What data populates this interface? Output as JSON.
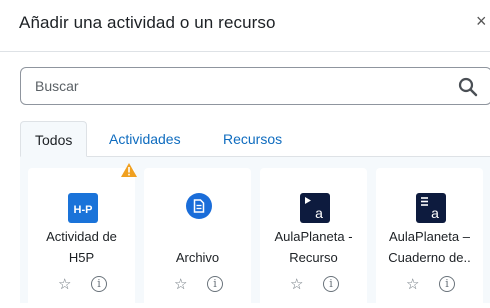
{
  "modal": {
    "title": "Añadir una actividad o un recurso",
    "close_glyph": "×"
  },
  "search": {
    "placeholder": "Buscar",
    "value": ""
  },
  "tabs": [
    {
      "label": "Todos",
      "active": true
    },
    {
      "label": "Actividades",
      "active": false
    },
    {
      "label": "Recursos",
      "active": false
    }
  ],
  "cards": [
    {
      "line1": "Actividad de",
      "line2": "H5P",
      "icon": "h5p-icon",
      "icon_text": "H-P",
      "badge": "warning-icon"
    },
    {
      "line1": "",
      "line2": "Archivo",
      "icon": "file-icon"
    },
    {
      "line1": "AulaPlaneta -",
      "line2": "Recurso",
      "icon": "aulaplaneta-recurso-icon",
      "icon_text": "a"
    },
    {
      "line1": "AulaPlaneta –",
      "line2": "Cuaderno de..",
      "icon": "aulaplaneta-cuaderno-icon",
      "icon_text": "a"
    }
  ],
  "card_actions": {
    "star_glyph": "☆",
    "info_glyph": "i"
  },
  "colors": {
    "accent": "#0f6cbf",
    "h5p": "#1a73d9",
    "file": "#1a6dd9",
    "aulaplaneta": "#0d1b3e",
    "warning": "#f0a020",
    "pane_bg": "#f5f9fc"
  }
}
